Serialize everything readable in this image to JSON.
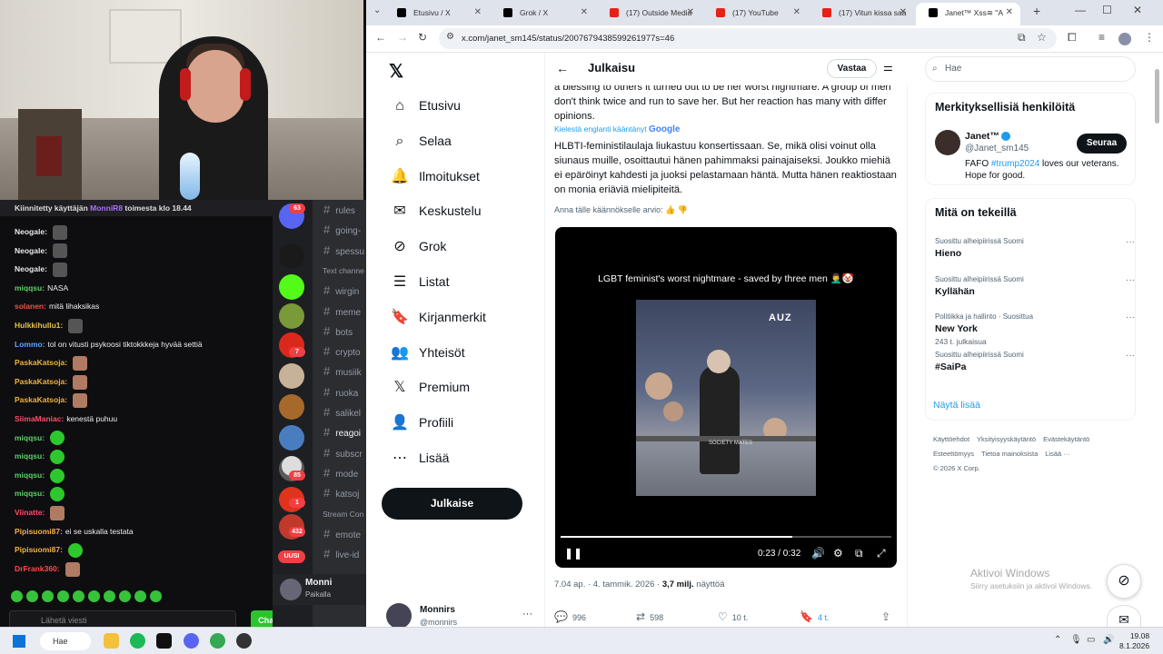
{
  "chat": {
    "pinned": {
      "prefix": "Kiinnitetty käyttäjän",
      "user": "MonniR8",
      "suffix": "toimesta klo 18.44"
    },
    "messages": [
      {
        "user": "Neogale:",
        "color": "#e8e8e8",
        "text": "",
        "emote": "dark"
      },
      {
        "user": "Neogale:",
        "color": "#e8e8e8",
        "text": "",
        "emote": "dark"
      },
      {
        "user": "Neogale:",
        "color": "#e8e8e8",
        "text": "",
        "emote": "dark"
      },
      {
        "user": "miqqsu:",
        "color": "#5ecf6a",
        "text": "NASA",
        "emote": ""
      },
      {
        "user": "solanen:",
        "color": "#ff4a4a",
        "text": "mitä lihaksikas",
        "emote": ""
      },
      {
        "user": "Hulkkihullu1:",
        "color": "#e8c04a",
        "text": "",
        "emote": "dark"
      },
      {
        "user": "Lommo:",
        "color": "#5ba7ff",
        "text": "tol on vitusti psykoosi tiktokkkeja hyvää settiä",
        "emote": ""
      },
      {
        "user": "PaskaKatsoja:",
        "color": "#f0b23c",
        "text": "",
        "emote": "face"
      },
      {
        "user": "PaskaKatsoja:",
        "color": "#f0b23c",
        "text": "",
        "emote": "face"
      },
      {
        "user": "PaskaKatsoja:",
        "color": "#f0b23c",
        "text": "",
        "emote": "face"
      },
      {
        "user": "SiimaManiac:",
        "color": "#ff4d6a",
        "text": "kenestä puhuu",
        "emote": ""
      },
      {
        "user": "miqqsu:",
        "color": "#5ecf6a",
        "text": "",
        "emote": "green"
      },
      {
        "user": "miqqsu:",
        "color": "#5ecf6a",
        "text": "",
        "emote": "green"
      },
      {
        "user": "miqqsu:",
        "color": "#5ecf6a",
        "text": "",
        "emote": "green"
      },
      {
        "user": "miqqsu:",
        "color": "#5ecf6a",
        "text": "",
        "emote": "green"
      },
      {
        "user": "Viinatte:",
        "color": "#ff4d6a",
        "text": "",
        "emote": "face"
      },
      {
        "user": "Pipisuomi87:",
        "color": "#f0b23c",
        "text": "ei se uskalla testata",
        "emote": ""
      },
      {
        "user": "Pipisuomi87:",
        "color": "#f0b23c",
        "text": "",
        "emote": "green"
      },
      {
        "user": "DrFrank360:",
        "color": "#ff4a4a",
        "text": "",
        "emote": "face"
      }
    ],
    "input_placeholder": "Lähetä viesti",
    "send_label": "Chatti"
  },
  "discord": {
    "channels": [
      {
        "name": "rules",
        "type": "ch"
      },
      {
        "name": "going-",
        "type": "ch"
      },
      {
        "name": "spessu",
        "type": "ch"
      },
      {
        "name": "Text channe",
        "type": "cat"
      },
      {
        "name": "wirgin",
        "type": "ch"
      },
      {
        "name": "meme",
        "type": "ch"
      },
      {
        "name": "bots",
        "type": "ch"
      },
      {
        "name": "crypto",
        "type": "ch"
      },
      {
        "name": "musiik",
        "type": "ch"
      },
      {
        "name": "ruoka",
        "type": "ch"
      },
      {
        "name": "salikel",
        "type": "ch"
      },
      {
        "name": "reagoi",
        "type": "active"
      },
      {
        "name": "subscr",
        "type": "ch"
      },
      {
        "name": "mode",
        "type": "ch"
      },
      {
        "name": "katsoj",
        "type": "ch"
      },
      {
        "name": "Stream Con",
        "type": "cat"
      },
      {
        "name": "emote",
        "type": "ch"
      },
      {
        "name": "live-id",
        "type": "ch"
      }
    ],
    "badges": [
      "63",
      "7",
      "85",
      "1",
      "432"
    ],
    "new_label": "UUSI",
    "user_name": "Monni",
    "user_status": "Paikalla"
  },
  "browser": {
    "tabs": [
      {
        "label": "Etusivu / X",
        "icon_color": "#000",
        "active": false
      },
      {
        "label": "Grok / X",
        "icon_color": "#000",
        "active": false
      },
      {
        "label": "(17) Outside Media",
        "icon_color": "#e62117",
        "active": false
      },
      {
        "label": "(17) YouTube",
        "icon_color": "#e62117",
        "active": false
      },
      {
        "label": "(17) Vitun kissa saa",
        "icon_color": "#e62117",
        "active": false
      },
      {
        "label": "Janet™ Xss≋ \"A",
        "icon_color": "#000",
        "active": true
      }
    ],
    "url": "x.com/janet_sm145/status/2007679438599261977s=46"
  },
  "x": {
    "nav": [
      "Etusivu",
      "Selaa",
      "Ilmoitukset",
      "Keskustelu",
      "Grok",
      "Listat",
      "Kirjanmerkit",
      "Yhteisöt",
      "Premium",
      "Profiili",
      "Lisää"
    ],
    "nav_icons": [
      "home-icon",
      "search-icon",
      "bell-icon",
      "mail-icon",
      "grok-icon",
      "list-icon",
      "bookmark-icon",
      "communities-icon",
      "x-premium-icon",
      "profile-icon",
      "more-icon"
    ],
    "post_button": "Julkaise",
    "account": {
      "name": "Monnirs",
      "handle": "@monnirs"
    },
    "header_title": "Julkaisu",
    "reply_button": "Vastaa",
    "original_text": "a blessing to others it turned out to be her worst nightmare. A group of men don't think twice and run to save her. But her reaction has many with differ opinions.",
    "translated_by": "Kielestä englanti kääntänyt",
    "google": "Google",
    "translation": "HLBTI-feministilaulaja liukastuu konsertissaan. Se, mikä olisi voinut olla siunaus muille, osoittautui hänen pahimmaksi painajaiseksi. Joukko miehiä ei epäröinyt kahdesti ja juoksi pelastamaan häntä. Mutta hänen reaktiostaan on monia eriäviä mielipiteitä.",
    "rate_translation": "Anna tälle käännökselle arvio:",
    "video": {
      "caption": "LGBT feminist's worst nightmare - saved by three men 🤦‍♂️🤡",
      "logo": "AUZ",
      "shirt": "SOCIETY MATES",
      "time": "0:23 / 0:32",
      "progress": 0.7
    },
    "meta": {
      "time": "7.04 ap. · 4. tammik. 2026 · ",
      "views": "3,7 milj.",
      "views_label": " näyttöä"
    },
    "actions": {
      "replies": "996",
      "reposts": "598",
      "likes": "10 t.",
      "bookmarks": "4 t."
    },
    "search_placeholder": "Hae",
    "who": {
      "title": "Merkityksellisiä henkilöitä",
      "name": "Janet™",
      "handle": "@Janet_sm145",
      "bio_pre": "FAFO ",
      "bio_tag": "#trump2024",
      "bio_post": " loves our veterans. Hope for good.",
      "follow": "Seuraa"
    },
    "happening": {
      "title": "Mitä on tekeillä",
      "trends": [
        {
          "context": "Suosittu alheipiirissä Suomi",
          "name": "Hieno",
          "posts": ""
        },
        {
          "context": "Suosittu alheipiirissä Suomi",
          "name": "Kyllähän",
          "posts": ""
        },
        {
          "context": "Politiikka ja hallinto · Suosittua",
          "name": "New York",
          "posts": "243 t. julkaisua"
        },
        {
          "context": "Suosittu alheipiirissä Suomi",
          "name": "#SaiPa",
          "posts": ""
        }
      ],
      "show_more": "Näytä lisää"
    },
    "footer": [
      "Käyttöehdot",
      "Yksityisyyskäytäntö",
      "Evästekäytäntö",
      "Esteettömyys",
      "Tietoa mainoksista",
      "Lisää ···",
      "© 2026 X Corp."
    ],
    "activate": {
      "title": "Aktivoi Windows",
      "subtitle": "Siirry asetuksiin ja aktivoi Windows."
    }
  },
  "taskbar": {
    "search": "Hae",
    "time": "19.08",
    "date": "8.1.2026"
  }
}
